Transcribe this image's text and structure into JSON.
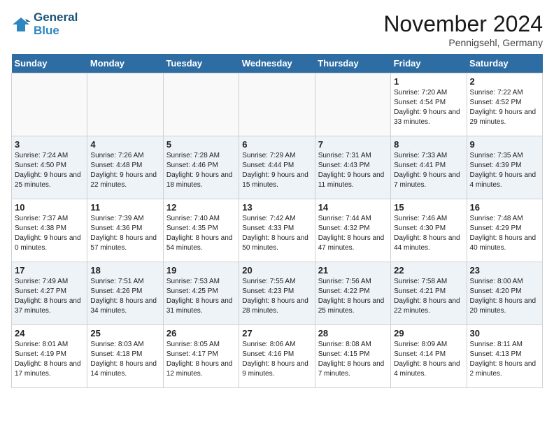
{
  "header": {
    "logo_line1": "General",
    "logo_line2": "Blue",
    "month": "November 2024",
    "location": "Pennigsehl, Germany"
  },
  "days_of_week": [
    "Sunday",
    "Monday",
    "Tuesday",
    "Wednesday",
    "Thursday",
    "Friday",
    "Saturday"
  ],
  "weeks": [
    [
      {
        "day": "",
        "info": ""
      },
      {
        "day": "",
        "info": ""
      },
      {
        "day": "",
        "info": ""
      },
      {
        "day": "",
        "info": ""
      },
      {
        "day": "",
        "info": ""
      },
      {
        "day": "1",
        "info": "Sunrise: 7:20 AM\nSunset: 4:54 PM\nDaylight: 9 hours and 33 minutes."
      },
      {
        "day": "2",
        "info": "Sunrise: 7:22 AM\nSunset: 4:52 PM\nDaylight: 9 hours and 29 minutes."
      }
    ],
    [
      {
        "day": "3",
        "info": "Sunrise: 7:24 AM\nSunset: 4:50 PM\nDaylight: 9 hours and 25 minutes."
      },
      {
        "day": "4",
        "info": "Sunrise: 7:26 AM\nSunset: 4:48 PM\nDaylight: 9 hours and 22 minutes."
      },
      {
        "day": "5",
        "info": "Sunrise: 7:28 AM\nSunset: 4:46 PM\nDaylight: 9 hours and 18 minutes."
      },
      {
        "day": "6",
        "info": "Sunrise: 7:29 AM\nSunset: 4:44 PM\nDaylight: 9 hours and 15 minutes."
      },
      {
        "day": "7",
        "info": "Sunrise: 7:31 AM\nSunset: 4:43 PM\nDaylight: 9 hours and 11 minutes."
      },
      {
        "day": "8",
        "info": "Sunrise: 7:33 AM\nSunset: 4:41 PM\nDaylight: 9 hours and 7 minutes."
      },
      {
        "day": "9",
        "info": "Sunrise: 7:35 AM\nSunset: 4:39 PM\nDaylight: 9 hours and 4 minutes."
      }
    ],
    [
      {
        "day": "10",
        "info": "Sunrise: 7:37 AM\nSunset: 4:38 PM\nDaylight: 9 hours and 0 minutes."
      },
      {
        "day": "11",
        "info": "Sunrise: 7:39 AM\nSunset: 4:36 PM\nDaylight: 8 hours and 57 minutes."
      },
      {
        "day": "12",
        "info": "Sunrise: 7:40 AM\nSunset: 4:35 PM\nDaylight: 8 hours and 54 minutes."
      },
      {
        "day": "13",
        "info": "Sunrise: 7:42 AM\nSunset: 4:33 PM\nDaylight: 8 hours and 50 minutes."
      },
      {
        "day": "14",
        "info": "Sunrise: 7:44 AM\nSunset: 4:32 PM\nDaylight: 8 hours and 47 minutes."
      },
      {
        "day": "15",
        "info": "Sunrise: 7:46 AM\nSunset: 4:30 PM\nDaylight: 8 hours and 44 minutes."
      },
      {
        "day": "16",
        "info": "Sunrise: 7:48 AM\nSunset: 4:29 PM\nDaylight: 8 hours and 40 minutes."
      }
    ],
    [
      {
        "day": "17",
        "info": "Sunrise: 7:49 AM\nSunset: 4:27 PM\nDaylight: 8 hours and 37 minutes."
      },
      {
        "day": "18",
        "info": "Sunrise: 7:51 AM\nSunset: 4:26 PM\nDaylight: 8 hours and 34 minutes."
      },
      {
        "day": "19",
        "info": "Sunrise: 7:53 AM\nSunset: 4:25 PM\nDaylight: 8 hours and 31 minutes."
      },
      {
        "day": "20",
        "info": "Sunrise: 7:55 AM\nSunset: 4:23 PM\nDaylight: 8 hours and 28 minutes."
      },
      {
        "day": "21",
        "info": "Sunrise: 7:56 AM\nSunset: 4:22 PM\nDaylight: 8 hours and 25 minutes."
      },
      {
        "day": "22",
        "info": "Sunrise: 7:58 AM\nSunset: 4:21 PM\nDaylight: 8 hours and 22 minutes."
      },
      {
        "day": "23",
        "info": "Sunrise: 8:00 AM\nSunset: 4:20 PM\nDaylight: 8 hours and 20 minutes."
      }
    ],
    [
      {
        "day": "24",
        "info": "Sunrise: 8:01 AM\nSunset: 4:19 PM\nDaylight: 8 hours and 17 minutes."
      },
      {
        "day": "25",
        "info": "Sunrise: 8:03 AM\nSunset: 4:18 PM\nDaylight: 8 hours and 14 minutes."
      },
      {
        "day": "26",
        "info": "Sunrise: 8:05 AM\nSunset: 4:17 PM\nDaylight: 8 hours and 12 minutes."
      },
      {
        "day": "27",
        "info": "Sunrise: 8:06 AM\nSunset: 4:16 PM\nDaylight: 8 hours and 9 minutes."
      },
      {
        "day": "28",
        "info": "Sunrise: 8:08 AM\nSunset: 4:15 PM\nDaylight: 8 hours and 7 minutes."
      },
      {
        "day": "29",
        "info": "Sunrise: 8:09 AM\nSunset: 4:14 PM\nDaylight: 8 hours and 4 minutes."
      },
      {
        "day": "30",
        "info": "Sunrise: 8:11 AM\nSunset: 4:13 PM\nDaylight: 8 hours and 2 minutes."
      }
    ]
  ]
}
